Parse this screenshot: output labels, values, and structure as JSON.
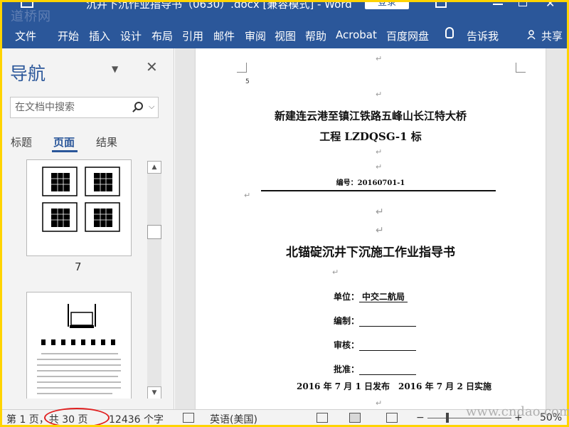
{
  "watermark": {
    "logo": "道桥网",
    "site": "www.cndao.com"
  },
  "titlebar": {
    "doc_title": "沉井下沉作业指导书（0630）.docx [兼容模式] - Word",
    "login": "登录"
  },
  "ribbon": {
    "tabs": [
      "文件",
      "开始",
      "插入",
      "设计",
      "布局",
      "引用",
      "邮件",
      "审阅",
      "视图",
      "帮助",
      "Acrobat",
      "百度网盘"
    ],
    "tell_me": "告诉我",
    "share": "共享"
  },
  "nav": {
    "title": "导航",
    "search_placeholder": "在文档中搜索",
    "tabs": [
      "标题",
      "页面",
      "结果"
    ],
    "active_tab": "页面",
    "thumbnails": [
      {
        "page": "7"
      },
      {
        "page": ""
      }
    ]
  },
  "document": {
    "page_marker": "5",
    "line1": "新建连云港至镇江铁路五峰山长江特大桥",
    "line2": "工程 LZDQSG-1 标",
    "doc_number": "编号：20160701-1",
    "main_title": "北锚碇沉井下沉施工作业指导书",
    "unit_label": "单位：",
    "unit_value": "中交二航局",
    "compile_label": "编制：",
    "review_label": "审核：",
    "approve_label": "批准：",
    "dates": "2016 年 7 月 1 日发布　2016 年 7 月 2 日实施",
    "para_mark": "↵"
  },
  "statusbar": {
    "page_info": "第 1 页，共 30 页",
    "word_count": "12436 个字",
    "language": "英语(美国)",
    "zoom": "50%",
    "zoom_minus": "−",
    "zoom_plus": "+"
  },
  "colors": {
    "ribbon": "#2B579A",
    "highlight_border": "#FFD400",
    "annotation": "#E02020"
  }
}
